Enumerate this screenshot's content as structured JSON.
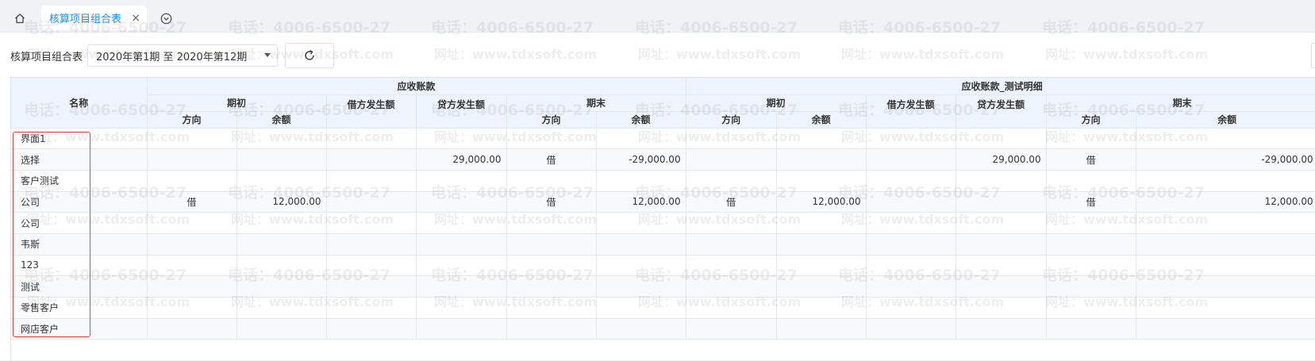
{
  "tabs": {
    "active_label": "核算项目组合表",
    "close_glyph": "×"
  },
  "toolbar": {
    "label": "核算项目组合表",
    "period_value": "2020年第1期 至 2020年第12期"
  },
  "watermark": {
    "phone": "电话：4006-6500-27",
    "site": "网址：www.tdxsoft.com"
  },
  "table": {
    "name_header": "名称",
    "groups": [
      {
        "title": "应收账款",
        "opening": "期初",
        "debit": "借方发生额",
        "credit": "贷方发生额",
        "closing": "期末",
        "direction": "方向",
        "balance": "余额"
      },
      {
        "title": "应收账款_测试明细",
        "opening": "期初",
        "debit": "借方发生额",
        "credit": "贷方发生额",
        "closing": "期末",
        "direction": "方向",
        "balance": "余额"
      }
    ],
    "rows": [
      {
        "name": "界面1",
        "cells": [
          "",
          "",
          "",
          "",
          "",
          "",
          "",
          "",
          "",
          "",
          "",
          ""
        ]
      },
      {
        "name": "选择",
        "cells": [
          "",
          "",
          "",
          "29,000.00",
          "借",
          "-29,000.00",
          "",
          "",
          "",
          "29,000.00",
          "借",
          "-29,000.00"
        ]
      },
      {
        "name": "客户测试",
        "cells": [
          "",
          "",
          "",
          "",
          "",
          "",
          "",
          "",
          "",
          "",
          "",
          ""
        ]
      },
      {
        "name": "公司",
        "cells": [
          "借",
          "12,000.00",
          "",
          "",
          "借",
          "12,000.00",
          "借",
          "12,000.00",
          "",
          "",
          "借",
          "12,000.00"
        ]
      },
      {
        "name": "公司",
        "cells": [
          "",
          "",
          "",
          "",
          "",
          "",
          "",
          "",
          "",
          "",
          "",
          ""
        ]
      },
      {
        "name": "韦斯",
        "cells": [
          "",
          "",
          "",
          "",
          "",
          "",
          "",
          "",
          "",
          "",
          "",
          ""
        ]
      },
      {
        "name": "123",
        "cells": [
          "",
          "",
          "",
          "",
          "",
          "",
          "",
          "",
          "",
          "",
          "",
          ""
        ]
      },
      {
        "name": "测试",
        "cells": [
          "",
          "",
          "",
          "",
          "",
          "",
          "",
          "",
          "",
          "",
          "",
          ""
        ]
      },
      {
        "name": "零售客户",
        "cells": [
          "",
          "",
          "",
          "",
          "",
          "",
          "",
          "",
          "",
          "",
          "",
          ""
        ]
      },
      {
        "name": "网店客户",
        "cells": [
          "",
          "",
          "",
          "",
          "",
          "",
          "",
          "",
          "",
          "",
          "",
          ""
        ]
      }
    ]
  },
  "colors": {
    "accent": "#1890ff",
    "header_bg": "#eef4fd",
    "highlight": "#e2473f"
  }
}
